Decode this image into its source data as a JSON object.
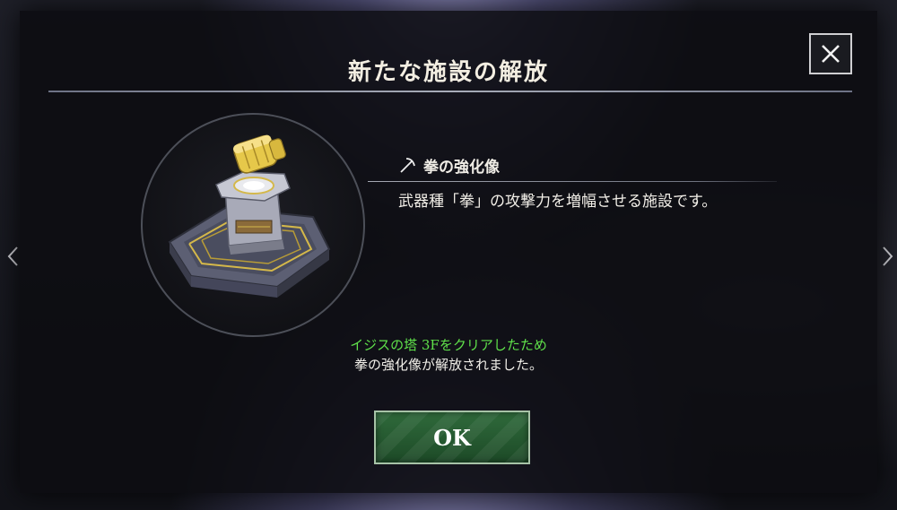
{
  "dialog": {
    "title": "新たな施設の解放",
    "close_icon": "close-icon",
    "facility": {
      "icon": "pickaxe-icon",
      "name": "拳の強化像",
      "description": "武器種「拳」の攻撃力を増幅させる施設です。",
      "image": "fist-statue-facility-image"
    },
    "notice": {
      "condition": "イジスの塔 3Fをクリアしたため",
      "result": "拳の強化像が解放されました。"
    },
    "ok_label": "OK"
  },
  "navigation": {
    "prev_icon": "chevron-left-icon",
    "next_icon": "chevron-right-icon"
  },
  "colors": {
    "highlight_green": "#5fe04a",
    "button_green": "#2f6a3b",
    "accent_gold": "#d4b84a"
  }
}
